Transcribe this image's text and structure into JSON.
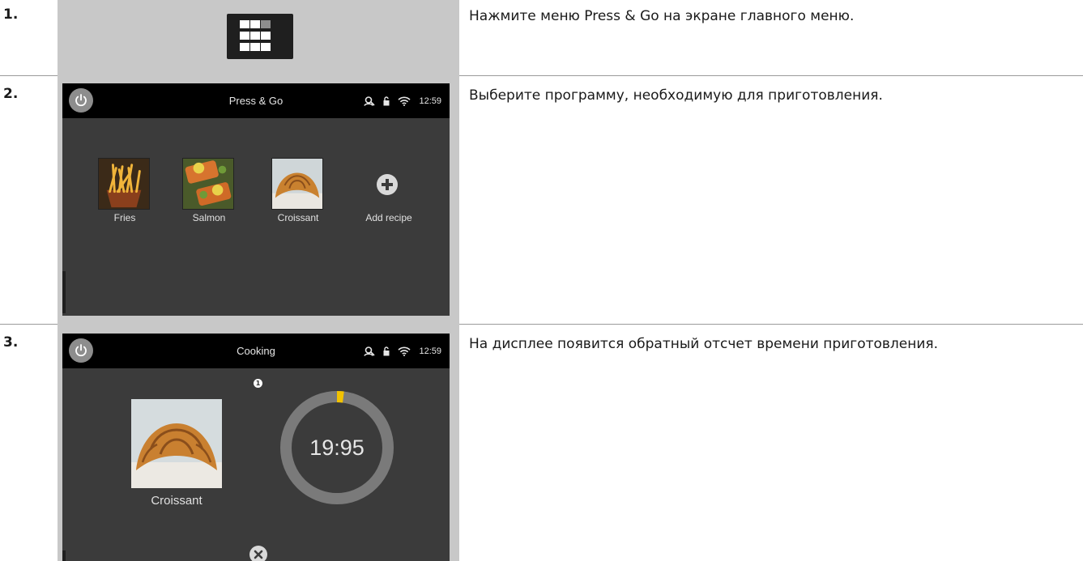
{
  "steps": [
    {
      "number": "1.",
      "text": "Нажмите меню Press & Go на экране главного меню."
    },
    {
      "number": "2.",
      "text": "Выберите программу, необходимую для приготовления."
    },
    {
      "number": "3.",
      "text": "На дисплее появится обратный отсчет времени приготовления."
    }
  ],
  "icons": {
    "main_menu": "grid-menu-icon",
    "power": "power-icon",
    "status": [
      "user-icon",
      "lock-icon",
      "wifi-icon"
    ],
    "add": "plus-icon",
    "cancel": "close-icon"
  },
  "screen_press_go": {
    "title": "Press & Go",
    "clock": "12:59",
    "recipes": [
      {
        "label": "Fries"
      },
      {
        "label": "Salmon"
      },
      {
        "label": "Croissant"
      },
      {
        "label": "Add recipe"
      }
    ]
  },
  "screen_cooking": {
    "title": "Cooking",
    "clock": "12:59",
    "info_badge": "1",
    "recipe_label": "Croissant",
    "timer": "19:95",
    "progress": 0.02
  },
  "colors": {
    "screen_bg": "#3b3b3b",
    "topbar_bg": "#000000",
    "ring_track": "#7a7a7a",
    "ring_progress": "#f2c200",
    "panel_bg": "#c8c8c8"
  }
}
